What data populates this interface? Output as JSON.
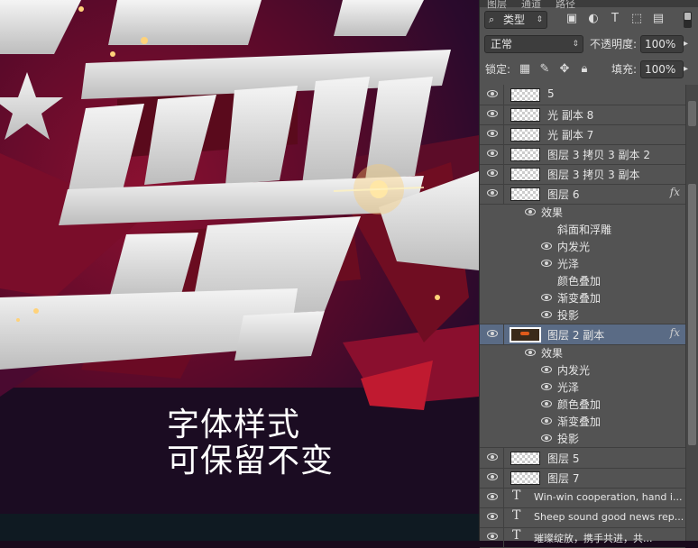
{
  "canvas": {
    "caption_line1": "字体样式",
    "caption_line2": "可保留不变"
  },
  "panel": {
    "tabs": [
      "图层",
      "通道",
      "路径"
    ],
    "filter_label": "类型",
    "filter_icons": [
      "image-filter-icon",
      "adjustment-filter-icon",
      "type-filter-icon",
      "shape-filter-icon",
      "smart-object-filter-icon"
    ],
    "blend_mode": "正常",
    "opacity_label": "不透明度:",
    "opacity_value": "100%",
    "lock_label": "锁定:",
    "fill_label": "填充:",
    "fill_value": "100%"
  },
  "layers": [
    {
      "name": "5",
      "type": "pixel"
    },
    {
      "name": "光 副本 8",
      "type": "pixel"
    },
    {
      "name": "光 副本 7",
      "type": "pixel"
    },
    {
      "name": "图层 3 拷贝 3 副本 2",
      "type": "pixel"
    },
    {
      "name": "图层 3 拷贝 3 副本",
      "type": "pixel"
    },
    {
      "name": "图层 6",
      "type": "pixel",
      "fx": "fx",
      "effects_label": "效果",
      "effects": [
        "斜面和浮雕",
        "内发光",
        "光泽",
        "颜色叠加",
        "渐变叠加",
        "投影"
      ]
    },
    {
      "name": "图层 2 副本",
      "type": "pixel",
      "fx": "fx",
      "selected": true,
      "effects_label": "效果",
      "effects": [
        "内发光",
        "光泽",
        "颜色叠加",
        "渐变叠加",
        "投影"
      ]
    },
    {
      "name": "图层 5",
      "type": "pixel"
    },
    {
      "name": "图层 7",
      "type": "pixel"
    },
    {
      "name": "Win-win cooperation, hand i...",
      "type": "text",
      "icon": "T"
    },
    {
      "name": "Sheep sound good news rep...",
      "type": "text",
      "icon": "T"
    },
    {
      "name": "璀璨绽放，携手共进，共...",
      "type": "text",
      "icon": "T"
    }
  ],
  "colors": {
    "panel_bg": "#535353",
    "selected_row": "#5a6b85",
    "canvas_red": "#8a1030"
  }
}
